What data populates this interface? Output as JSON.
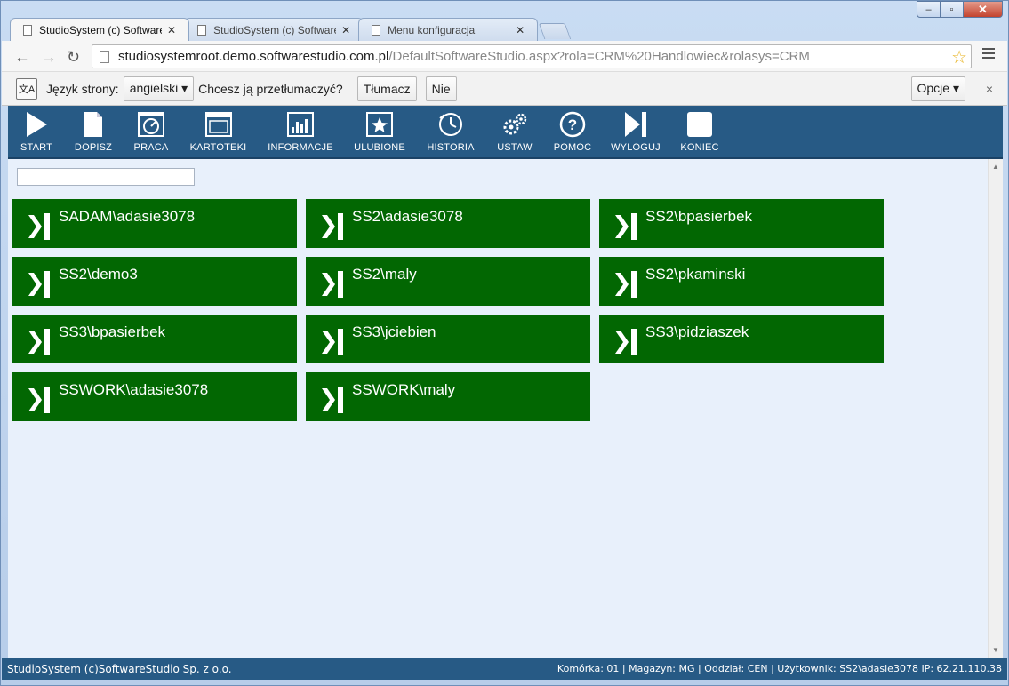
{
  "window": {
    "controls": {
      "minimize": "‒",
      "maximize": "▫",
      "close": "✕"
    }
  },
  "tabs": [
    {
      "title": "StudioSystem (c) Software",
      "active": true,
      "close": "✕"
    },
    {
      "title": "StudioSystem (c) Software",
      "active": false,
      "close": "✕"
    },
    {
      "title": "Menu konfiguracja",
      "active": false,
      "close": "✕"
    }
  ],
  "toolbar": {
    "back": "←",
    "forward": "→",
    "reload": "↻",
    "url_host": "studiosystemroot.demo.softwarestudio.com.pl",
    "url_path": "/DefaultSoftwareStudio.aspx?rola=CRM%20Handlowiec&rolasys=CRM",
    "star": "☆"
  },
  "translate_bar": {
    "label": "Język strony:",
    "language": "angielski ▾",
    "question": "Chcesz ją przetłumaczyć?",
    "translate_btn": "Tłumacz",
    "no_btn": "Nie",
    "options_btn": "Opcje ▾",
    "close": "×"
  },
  "menu": [
    {
      "label": "START",
      "icon": "play-icon"
    },
    {
      "label": "DOPISZ",
      "icon": "document-icon"
    },
    {
      "label": "PRACA",
      "icon": "gauge-icon"
    },
    {
      "label": "KARTOTEKI",
      "icon": "window-icon"
    },
    {
      "label": "INFORMACJE",
      "icon": "chart-icon"
    },
    {
      "label": "ULUBIONE",
      "icon": "star-icon"
    },
    {
      "label": "HISTORIA",
      "icon": "clock-icon"
    },
    {
      "label": "USTAW",
      "icon": "gears-icon"
    },
    {
      "label": "POMOC",
      "icon": "help-icon"
    },
    {
      "label": "WYLOGUJ",
      "icon": "logout-icon"
    },
    {
      "label": "KONIEC",
      "icon": "stop-icon"
    }
  ],
  "search": {
    "value": "",
    "placeholder": ""
  },
  "tiles": [
    "SADAM\\adasie3078",
    "SS2\\adasie3078",
    "SS2\\bpasierbek",
    "SS2\\demo3",
    "SS2\\maly",
    "SS2\\pkaminski",
    "SS3\\bpasierbek",
    "SS3\\jciebien",
    "SS3\\pidziaszek",
    "SSWORK\\adasie3078",
    "SSWORK\\maly"
  ],
  "status": {
    "left": "StudioSystem (c)SoftwareStudio Sp. z o.o.",
    "right": "Komórka: 01 | Magazyn: MG | Oddział: CEN | Użytkownik: SS2\\adasie3078 IP: 62.21.110.38"
  },
  "colors": {
    "tile": "#026702",
    "menu_bar": "#275a85",
    "content_bg": "#e8f0fb"
  }
}
